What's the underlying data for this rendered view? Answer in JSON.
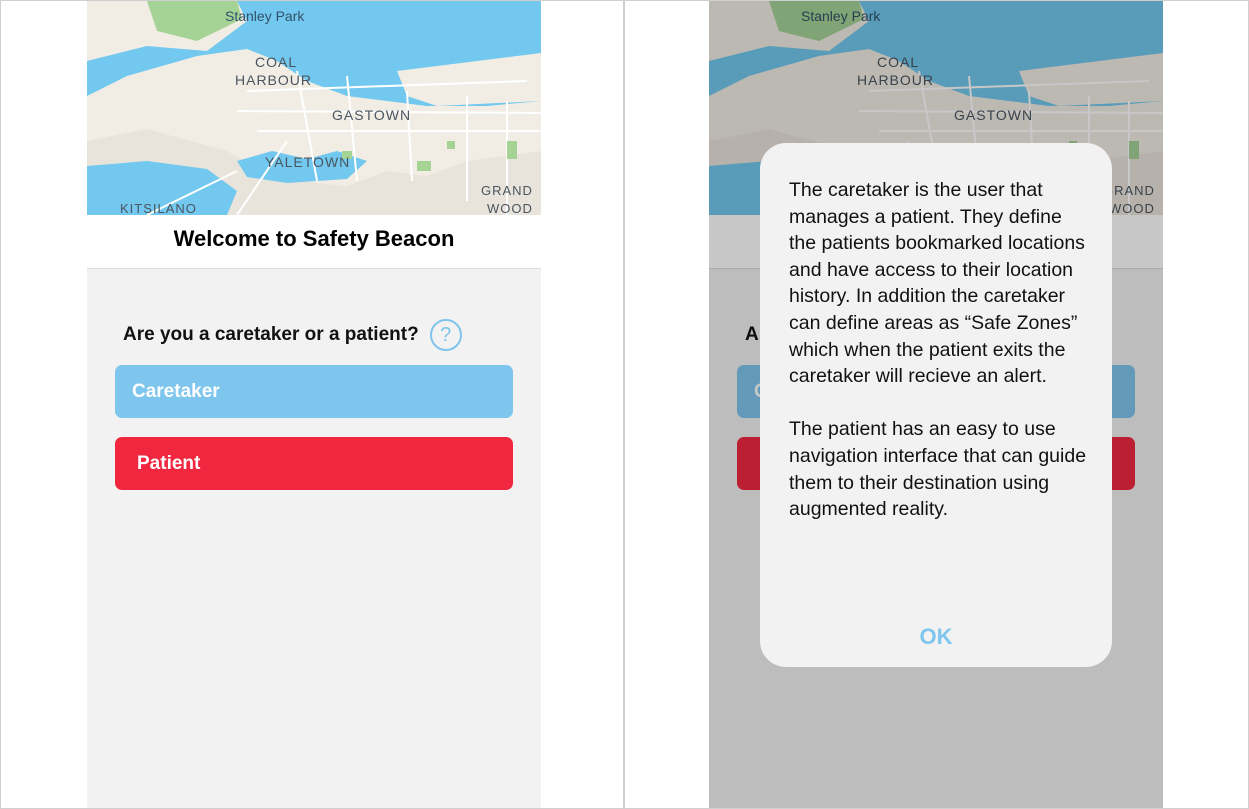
{
  "colors": {
    "water": "#72c8ee",
    "land": "#f1ede5",
    "park": "#a5d396",
    "accent": "#7fc6ee",
    "patient": "#f12740",
    "alert_bg": "#f2f2f2"
  },
  "map": {
    "labels": {
      "stanley_park": "Stanley Park",
      "coal": "COAL",
      "harbour": "HARBOUR",
      "gastown": "GASTOWN",
      "yaletown": "YALETOWN",
      "kitsilano": "KITSILANO",
      "grand": "GRAND",
      "wood": "WOOD"
    }
  },
  "welcome": {
    "title": "Welcome to Safety Beacon",
    "question": "Are you a caretaker or a patient?",
    "help_icon": "question-circle-icon",
    "help_glyph": "?",
    "caretaker_label": "Caretaker",
    "patient_label": "Patient"
  },
  "alert": {
    "message": "The caretaker is the user that manages a patient. They define the patients bookmarked locations and have access to their location history. In addition the caretaker can define areas as “Safe Zones” which when the patient exits the caretaker will recieve an alert.\n\nThe patient has an easy to use navigation interface that can guide them to their destination using augmented reality.",
    "ok_label": "OK"
  }
}
